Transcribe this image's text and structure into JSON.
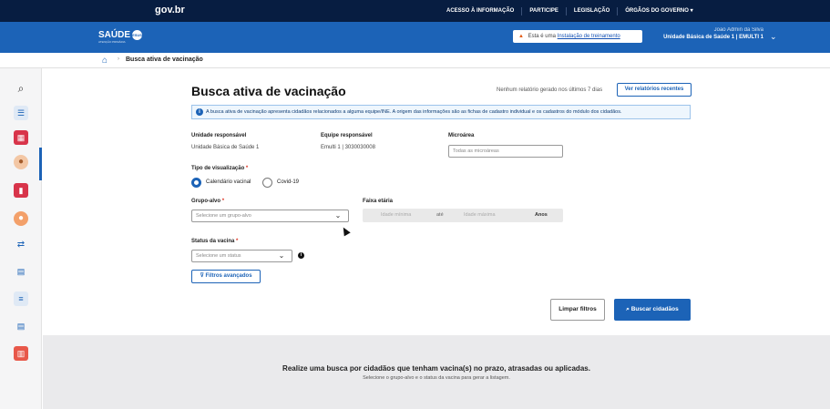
{
  "govbar": {
    "logo": "gov.br",
    "links": [
      "ACESSO À INFORMAÇÃO",
      "PARTICIPE",
      "LEGISLAÇÃO",
      "ÓRGÃOS DO GOVERNO ▾"
    ]
  },
  "header": {
    "brand": "SAÚDE",
    "brand_badge": "ESUS",
    "brand_sub": "ATENÇÃO PRIMÁRIA",
    "alert_prefix": "Esta é uma",
    "alert_link": "Instalação de treinamento",
    "user_name": "João Admin da Silva",
    "user_unit": "Unidade Básica de Saúde 1 | EMULTI 1"
  },
  "breadcrumb": {
    "current": "Busca ativa de vacinação"
  },
  "page": {
    "title": "Busca ativa de vacinação",
    "report_note": "Nenhum relatório gerado nos últimos 7 dias",
    "report_button": "Ver relatórios recentes",
    "info": "A busca ativa de vacinação apresenta cidadãos relacionados a alguma equipe/INE. A origem das informações são as fichas de cadastro individual e os cadastros do módulo dos cidadãos."
  },
  "form": {
    "unidade_label": "Unidade responsável",
    "unidade_value": "Unidade Básica de Saúde 1",
    "equipe_label": "Equipe responsável",
    "equipe_value": "Emulti 1 | 3030030008",
    "microarea_label": "Microárea",
    "microarea_placeholder": "Todas as microáreas",
    "tipo_label": "Tipo de visualização",
    "tipo_options": [
      "Calendário vacinal",
      "Covid-19"
    ],
    "grupo_label": "Grupo-alvo",
    "grupo_placeholder": "Selecione um grupo-alvo",
    "faixa_label": "Faixa etária",
    "faixa_min": "Idade mínima",
    "faixa_ate": "até",
    "faixa_max": "Idade máxima",
    "faixa_unit": "Anos",
    "status_label": "Status da vacina",
    "status_placeholder": "Selecione um status",
    "advanced_filters": "Filtros avançados",
    "clear_button": "Limpar filtros",
    "search_button": "Buscar cidadãos"
  },
  "empty_state": {
    "title": "Realize uma busca por cidadãos que tenham vacina(s) no prazo, atrasadas ou aplicadas.",
    "subtitle": "Selecione o grupo-alvo e o status da vacina para gerar a listagem."
  },
  "colors": {
    "gov_navy": "#071d41",
    "brand_blue": "#1c63b7",
    "warning": "#e25b16"
  },
  "sidebar_icons": [
    "search-icon",
    "search-list-icon",
    "calendar-icon",
    "person-search-icon",
    "book-icon",
    "person-icon",
    "transfer-icon",
    "table-search-icon",
    "list-icon",
    "table-person-icon",
    "report-icon"
  ]
}
